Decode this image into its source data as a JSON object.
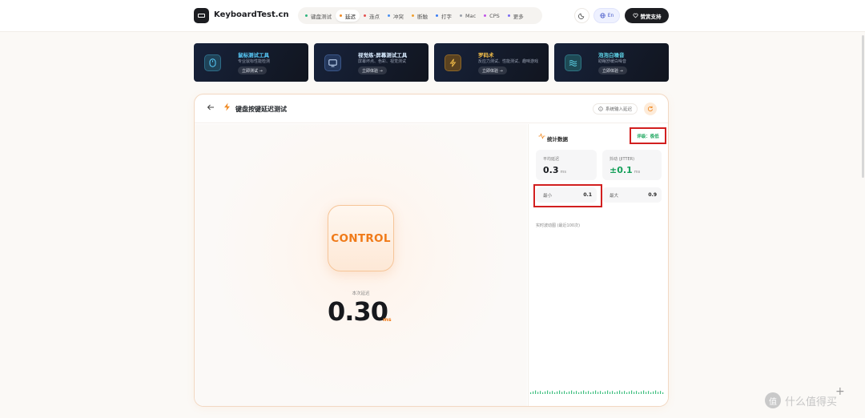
{
  "brand": {
    "name": "KeyboardTest.cn"
  },
  "nav": {
    "items": [
      {
        "label": "键盘测试",
        "color": "#2db47d"
      },
      {
        "label": "延迟",
        "color": "#f08a24",
        "active": true
      },
      {
        "label": "连点",
        "color": "#e45050"
      },
      {
        "label": "冲突",
        "color": "#4a8ff0"
      },
      {
        "label": "断触",
        "color": "#f0a030"
      },
      {
        "label": "打字",
        "color": "#3b7df5"
      },
      {
        "label": "Mac",
        "color": "#9aa0aa"
      },
      {
        "label": "CPS",
        "color": "#c054e8"
      },
      {
        "label": "更多",
        "color": "#7a6cf0"
      }
    ],
    "lang": "En",
    "support": "赞赏支持"
  },
  "promos": [
    {
      "title": "鼠标测试工具",
      "subtitle": "专业鼠标性能检测",
      "button": "立即测试 →",
      "title_color": "#5ad0ff",
      "icon": "mouse-icon"
    },
    {
      "title": "视觉练-屏幕测试工具",
      "subtitle": "屏幕坏点、色彩、视觉测试",
      "button": "立即体验 →",
      "title_color": "#9fd6ff",
      "icon": "monitor-icon"
    },
    {
      "title": "罗码术",
      "subtitle": "反应力测试、性能测试、趣味游戏",
      "button": "立即体验 →",
      "title_color": "#f5c04a",
      "icon": "lightning-icon"
    },
    {
      "title": "泡泡白噪音",
      "subtitle": "助眠舒缓白噪音",
      "button": "立即体验 →",
      "title_color": "#5fd4e8",
      "icon": "wave-icon"
    }
  ],
  "panel": {
    "title": "键盘按键延迟测试",
    "sys_delay": "系统输入延迟",
    "key": "CONTROL",
    "current_label": "本次延迟",
    "current_value": "0.30",
    "current_unit": "ms"
  },
  "stats": {
    "title": "统计数据",
    "rating": "评级：极低",
    "avg": {
      "label": "平均延迟",
      "value": "0.3",
      "unit": "ms"
    },
    "jitter": {
      "label": "抖动 (JITTER)",
      "value": "±0.1",
      "unit": "ms"
    },
    "min": {
      "label": "最小",
      "value": "0.1"
    },
    "max": {
      "label": "最大",
      "value": "0.9"
    },
    "wave_label": "实时波动图 (最近100次)"
  },
  "watermark": "什么值得买"
}
